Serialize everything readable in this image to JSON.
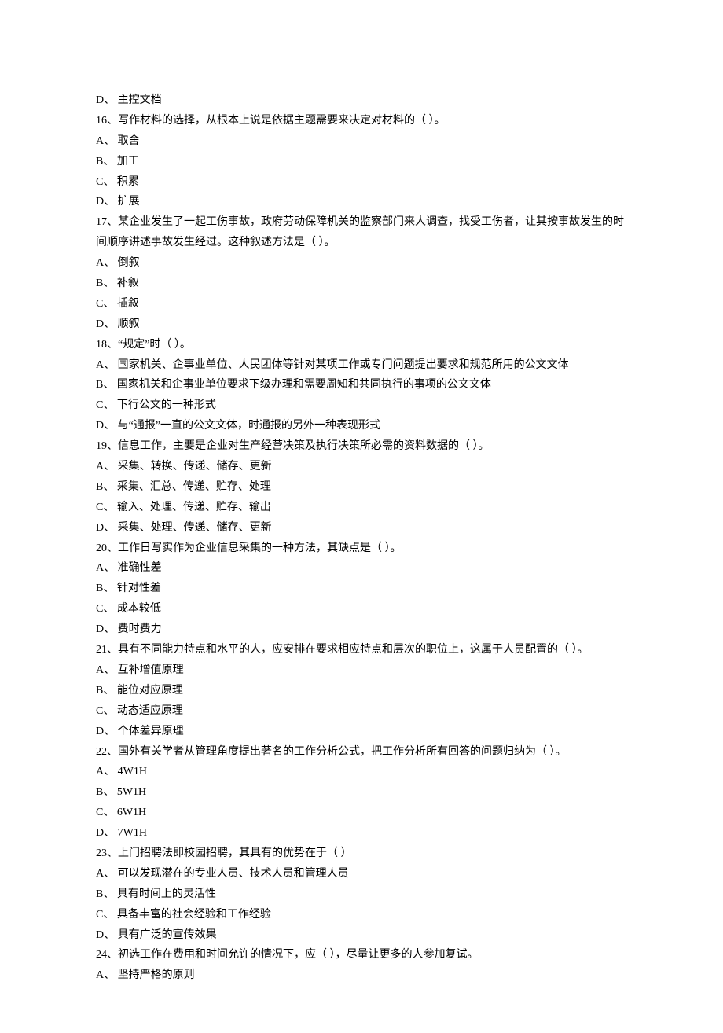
{
  "lines": [
    "D、  主控文档",
    "16、写作材料的选择，从根本上说是依据主题需要来决定对材料的（  ）。",
    "A、  取舍",
    "B、  加工",
    "C、  积累",
    "D、  扩展",
    "17、某企业发生了一起工伤事故，政府劳动保障机关的监察部门来人调查，找受工伤者，让其按事故发生的时间顺序讲述事故发生经过。这种叙述方法是（  ）。",
    "A、  倒叙",
    "B、  补叙",
    "C、  插叙",
    "D、  顺叙",
    "18、“规定”时（  ）。",
    "A、  国家机关、企事业单位、人民团体等针对某项工作或专门问题提出要求和规范所用的公文文体",
    "B、  国家机关和企事业单位要求下级办理和需要周知和共同执行的事项的公文文体",
    "C、  下行公文的一种形式",
    "D、  与“通报”一直的公文文体，时通报的另外一种表现形式",
    "19、信息工作，主要是企业对生产经营决策及执行决策所必需的资料数据的（  ）。",
    "A、  采集、转换、传递、储存、更新",
    "B、  采集、汇总、传递、贮存、处理",
    "C、  输入、处理、传递、贮存、输出",
    "D、  采集、处理、传递、储存、更新",
    "20、工作日写实作为企业信息采集的一种方法，其缺点是（  ）。",
    "A、  准确性差",
    "B、  针对性差",
    "C、  成本较低",
    "D、  费时费力",
    "21、具有不同能力特点和水平的人，应安排在要求相应特点和层次的职位上，这属于人员配置的（  ）。",
    "A、  互补增值原理",
    "B、  能位对应原理",
    "C、  动态适应原理",
    "D、  个体差异原理",
    "22、国外有关学者从管理角度提出著名的工作分析公式，把工作分析所有回答的问题归纳为（  ）。",
    "A、  4W1H",
    "B、  5W1H",
    "C、  6W1H",
    "D、  7W1H",
    "23、上门招聘法即校园招聘，其具有的优势在于（  ）",
    "A、  可以发现潜在的专业人员、技术人员和管理人员",
    "B、  具有时间上的灵活性",
    "C、  具备丰富的社会经验和工作经验",
    "D、  具有广泛的宣传效果",
    "24、初选工作在费用和时间允许的情况下，应（  ），尽量让更多的人参加复试。",
    "A、  坚持严格的原则"
  ]
}
